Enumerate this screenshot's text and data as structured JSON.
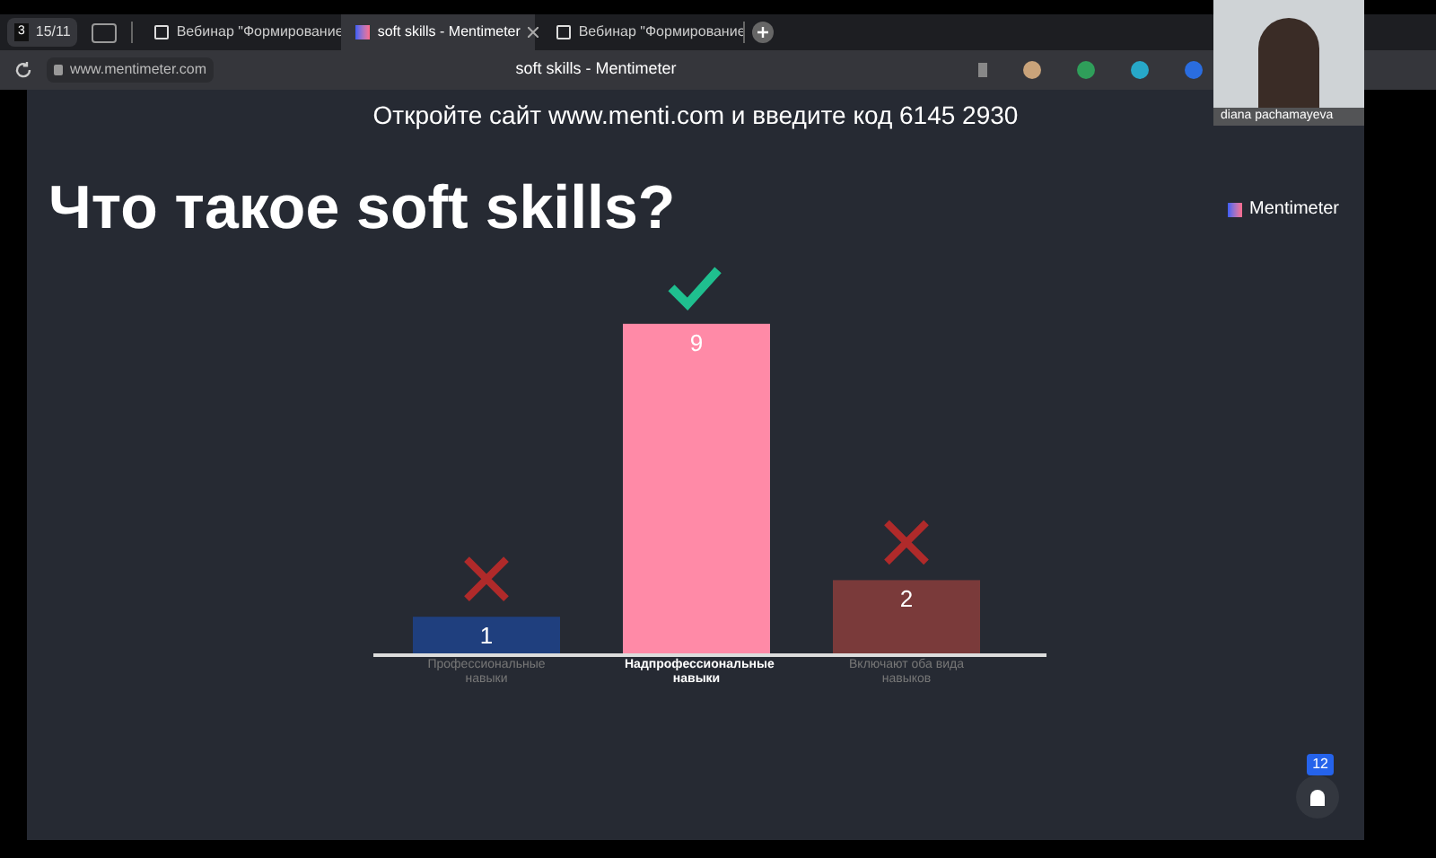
{
  "browser": {
    "workspace_badge": "3",
    "tab_counter": "15/11",
    "tabs": [
      {
        "title": "Вебинар \"Формирование",
        "selected": false,
        "kind": "check"
      },
      {
        "title": "soft skills - Mentimeter",
        "selected": true,
        "kind": "menti"
      },
      {
        "title": "Вебинар \"Формирование",
        "selected": false,
        "kind": "check"
      }
    ],
    "url": "www.mentimeter.com",
    "page_title": "soft skills - Mentimeter"
  },
  "video": {
    "name": "diana pachamayeva"
  },
  "slide": {
    "instructions": "Откройте сайт www.menti.com и введите код 6145 2930",
    "question": "Что такое soft skills?",
    "brand": "Mentimeter",
    "answers": [
      {
        "color": "#1f3f7e",
        "correct": false,
        "highlighted": false
      },
      {
        "color": "#ff8aa7",
        "correct": true,
        "highlighted": true
      },
      {
        "color": "#7a3a3a",
        "correct": false,
        "highlighted": false
      }
    ],
    "chart_data": {
      "type": "bar",
      "categories": [
        "Профессиональные навыки",
        "Надпрофессиональные навыки",
        "Включают оба вида навыков"
      ],
      "values": [
        1,
        9,
        2
      ],
      "data_labels": true
    },
    "participants": "12"
  }
}
